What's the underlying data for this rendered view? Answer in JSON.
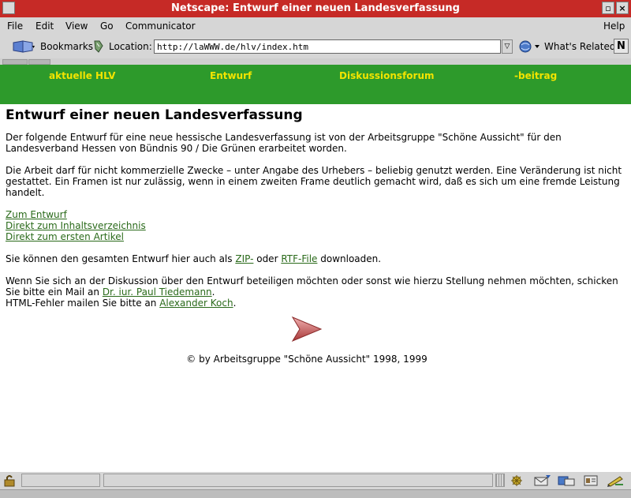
{
  "window": {
    "title": "Netscape: Entwurf einer neuen Landesverfassung",
    "minimize_glyph": "▫",
    "close_glyph": "×"
  },
  "menu": {
    "items": [
      "File",
      "Edit",
      "View",
      "Go",
      "Communicator"
    ],
    "help": "Help"
  },
  "toolbar": {
    "bookmarks_label": "Bookmarks",
    "location_label": "Location:",
    "url": "http://laWWW.de/hlv/index.htm",
    "whats_related_label": "What's Related",
    "netscape_logo": "N"
  },
  "nav": {
    "items": [
      "aktuelle HLV",
      "Entwurf",
      "Diskussionsforum",
      "-beitrag"
    ]
  },
  "content": {
    "heading": "Entwurf einer neuen Landesverfassung",
    "para1": "Der folgende Entwurf für eine neue hessische Landesverfassung ist von der Arbeitsgruppe \"Schöne Aussicht\" für den Landesverband Hessen von Bündnis 90 / Die Grünen erarbeitet worden.",
    "para2": "Die Arbeit darf für nicht kommerzielle Zwecke – unter Angabe des Urhebers – beliebig genutzt werden. Eine Veränderung ist nicht gestattet. Ein Framen ist nur zulässig, wenn in einem zweiten Frame deutlich gemacht wird, daß es sich um eine fremde Leistung handelt.",
    "links": [
      "Zum Entwurf",
      "Direkt zum Inhaltsverzeichnis",
      "Direkt zum ersten Artikel"
    ],
    "download_pre": "Sie können den gesamten Entwurf hier auch als ",
    "download_zip": "ZIP-",
    "download_mid": " oder ",
    "download_rtf": "RTF-File",
    "download_post": " downloaden.",
    "contact_pre": "Wenn Sie sich an der Diskussion über den Entwurf beteiligen möchten oder sonst wie hierzu Stellung nehmen möchten, schicken Sie bitte ein Mail an ",
    "contact_link": "Dr. iur. Paul Tiedemann",
    "contact_post": ".",
    "html_error_pre": "HTML-Fehler mailen Sie bitte an ",
    "html_error_link": "Alexander Koch",
    "html_error_post": ".",
    "copyright": "© by Arbeitsgruppe \"Schöne Aussicht\" 1998, 1999"
  },
  "colors": {
    "title_bar": "#c62a26",
    "nav_bg": "#2d9a2b",
    "nav_text": "#f2e400",
    "link": "#2a6a1a",
    "arrow": "#c85a5a"
  }
}
